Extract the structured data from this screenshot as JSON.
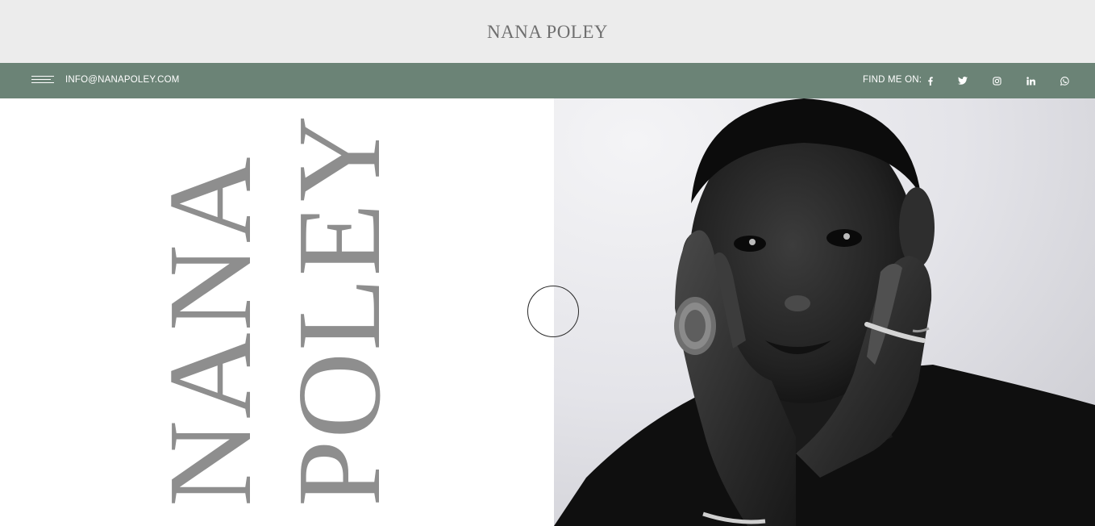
{
  "header": {
    "brand": "NANA POLEY"
  },
  "contact_bar": {
    "email": "INFO@NANAPOLEY.COM",
    "find_me_label": "FIND ME ON:",
    "social": [
      "facebook-icon",
      "twitter-icon",
      "instagram-icon",
      "linkedin-icon",
      "whatsapp-icon"
    ]
  },
  "hero": {
    "word_1": "NANA",
    "word_2": "POLEY",
    "photo": "portrait-photo"
  },
  "colors": {
    "topbar_bg": "#ececec",
    "accent_green": "#6b8376",
    "title_gray": "#8e8e8e"
  }
}
